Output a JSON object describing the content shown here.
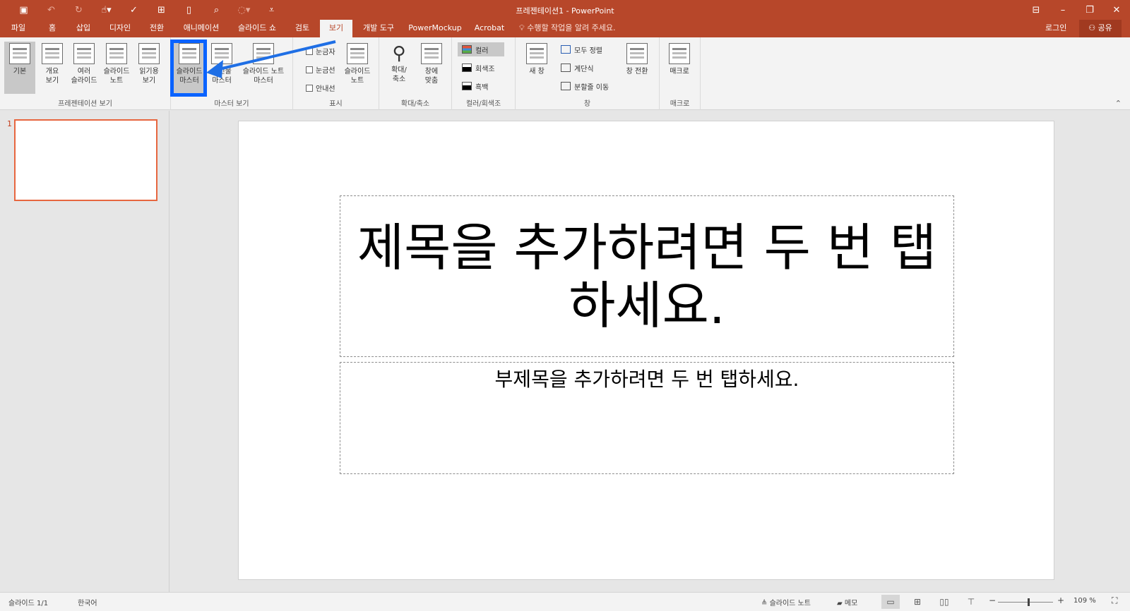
{
  "titlebar": {
    "title": "프레젠테이션1 - PowerPoint",
    "qat_icons": [
      "save-icon",
      "undo-icon",
      "redo-icon",
      "touch-mode-icon",
      "spelling-icon",
      "presenter-icon",
      "new-icon",
      "print-preview-icon",
      "format-painter-icon",
      "customize-icon"
    ],
    "window_icons": [
      "ribbon-display-icon",
      "minimize-icon",
      "restore-icon",
      "close-icon"
    ]
  },
  "tabs": [
    "파일",
    "홈",
    "삽입",
    "디자인",
    "전환",
    "애니메이션",
    "슬라이드 쇼",
    "검토",
    "보기",
    "개발 도구",
    "PowerMockup",
    "Acrobat"
  ],
  "active_tab": "보기",
  "tell_me": "수행할 작업을 알려 주세요.",
  "login": "로그인",
  "share": "공유",
  "ribbon": {
    "presentation_views": {
      "label": "프레젠테이션 보기",
      "buttons": [
        "기본",
        "개요\n보기",
        "여러\n슬라이드",
        "슬라이드\n노트",
        "읽기용\n보기"
      ]
    },
    "master_views": {
      "label": "마스터 보기",
      "buttons": [
        "슬라이드\n마스터",
        "유인물\n마스터",
        "슬라이드 노트\n마스터"
      ]
    },
    "show": {
      "label": "표시",
      "checks": [
        "눈금자",
        "눈금선",
        "안내선"
      ],
      "notes_button": "슬라이드\n노트"
    },
    "zoom": {
      "label": "확대/축소",
      "buttons": [
        "확대/\n축소",
        "창에\n맞춤"
      ]
    },
    "color": {
      "label": "컬러/회색조",
      "options": [
        "컬러",
        "회색조",
        "흑백"
      ]
    },
    "window": {
      "label": "창",
      "new_window": "새 창",
      "arrange_all": "모두 정렬",
      "cascade": "계단식",
      "move_split": "분할줄 이동",
      "switch_windows": "창 전환"
    },
    "macros": {
      "label": "매크로",
      "button": "매크로"
    }
  },
  "slides": {
    "current_number": "1"
  },
  "slide": {
    "title_placeholder": "제목을 추가하려면 두 번 탭하세요.",
    "subtitle_placeholder": "부제목을 추가하려면 두 번 탭하세요."
  },
  "status": {
    "slide_info": "슬라이드 1/1",
    "language": "한국어",
    "notes": "슬라이드 노트",
    "comments": "메모",
    "zoom_level": "109 %",
    "zoom_fraction": 0.55
  },
  "colors": {
    "accent": "#b7472a",
    "highlight": "#0a63ff",
    "thumb_border": "#e7663f"
  }
}
